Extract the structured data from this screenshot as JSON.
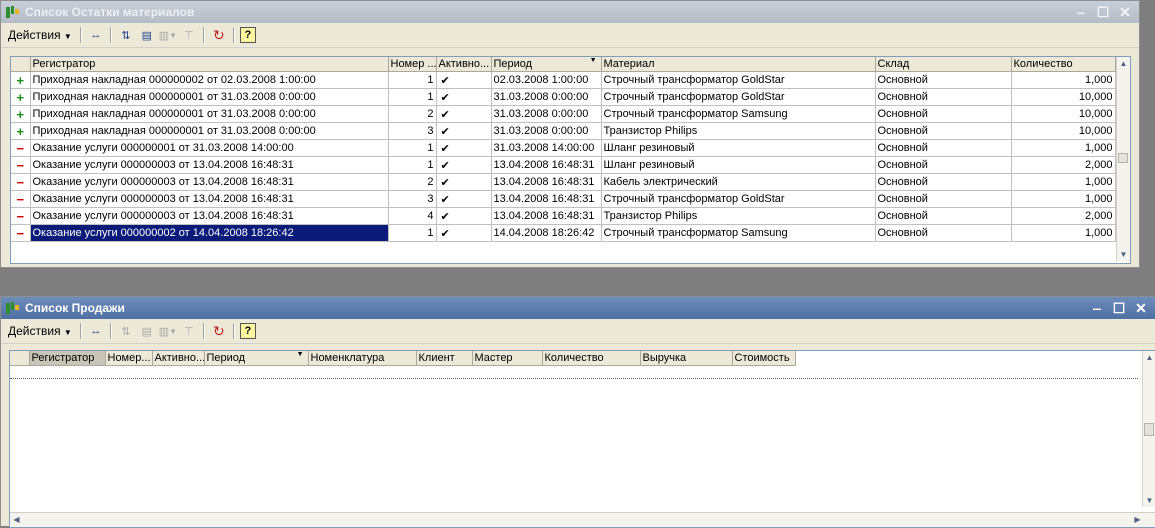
{
  "win1": {
    "title": "Список Остатки материалов",
    "toolbar": {
      "actions": "Действия"
    },
    "columns": [
      "Регистратор",
      "Номер ...",
      "Активно...",
      "Период",
      "Материал",
      "Склад",
      "Количество"
    ],
    "rows": [
      {
        "type": "plus",
        "mark": "+",
        "registrar": "Приходная накладная 000000002 от 02.03.2008 1:00:00",
        "num": "1",
        "active": "✔",
        "period": "02.03.2008 1:00:00",
        "material": "Строчный трансформатор GoldStar",
        "warehouse": "Основной",
        "qty": "1,000"
      },
      {
        "type": "plus",
        "mark": "+",
        "registrar": "Приходная накладная 000000001 от 31.03.2008 0:00:00",
        "num": "1",
        "active": "✔",
        "period": "31.03.2008 0:00:00",
        "material": "Строчный трансформатор GoldStar",
        "warehouse": "Основной",
        "qty": "10,000"
      },
      {
        "type": "plus",
        "mark": "+",
        "registrar": "Приходная накладная 000000001 от 31.03.2008 0:00:00",
        "num": "2",
        "active": "✔",
        "period": "31.03.2008 0:00:00",
        "material": "Строчный трансформатор Samsung",
        "warehouse": "Основной",
        "qty": "10,000"
      },
      {
        "type": "plus",
        "mark": "+",
        "registrar": "Приходная накладная 000000001 от 31.03.2008 0:00:00",
        "num": "3",
        "active": "✔",
        "period": "31.03.2008 0:00:00",
        "material": "Транзистор Philips",
        "warehouse": "Основной",
        "qty": "10,000"
      },
      {
        "type": "minus",
        "mark": "−",
        "registrar": "Оказание услуги 000000001 от 31.03.2008 14:00:00",
        "num": "1",
        "active": "✔",
        "period": "31.03.2008 14:00:00",
        "material": "Шланг резиновый",
        "warehouse": "Основной",
        "qty": "1,000"
      },
      {
        "type": "minus",
        "mark": "−",
        "registrar": "Оказание услуги 000000003 от 13.04.2008 16:48:31",
        "num": "1",
        "active": "✔",
        "period": "13.04.2008 16:48:31",
        "material": "Шланг резиновый",
        "warehouse": "Основной",
        "qty": "2,000"
      },
      {
        "type": "minus",
        "mark": "−",
        "registrar": "Оказание услуги 000000003 от 13.04.2008 16:48:31",
        "num": "2",
        "active": "✔",
        "period": "13.04.2008 16:48:31",
        "material": "Кабель электрический",
        "warehouse": "Основной",
        "qty": "1,000"
      },
      {
        "type": "minus",
        "mark": "−",
        "registrar": "Оказание услуги 000000003 от 13.04.2008 16:48:31",
        "num": "3",
        "active": "✔",
        "period": "13.04.2008 16:48:31",
        "material": "Строчный трансформатор GoldStar",
        "warehouse": "Основной",
        "qty": "1,000"
      },
      {
        "type": "minus",
        "mark": "−",
        "registrar": "Оказание услуги 000000003 от 13.04.2008 16:48:31",
        "num": "4",
        "active": "✔",
        "period": "13.04.2008 16:48:31",
        "material": "Транзистор Philips",
        "warehouse": "Основной",
        "qty": "2,000"
      },
      {
        "type": "minus",
        "mark": "−",
        "registrar": "Оказание услуги 000000002 от 14.04.2008 18:26:42",
        "num": "1",
        "active": "✔",
        "period": "14.04.2008 18:26:42",
        "material": "Строчный трансформатор Samsung",
        "warehouse": "Основной",
        "qty": "1,000",
        "selected": true
      }
    ]
  },
  "win2": {
    "title": "Список Продажи",
    "toolbar": {
      "actions": "Действия"
    },
    "columns": [
      "Регистратор",
      "Номер...",
      "Активно...",
      "Период",
      "Номенклатура",
      "Клиент",
      "Мастер",
      "Количество",
      "Выручка",
      "Стоимость"
    ]
  },
  "colors": {
    "selection": "#0a1b7a",
    "plus": "#1a8c1a",
    "minus": "#cc0000",
    "active_title": "#4f70a4"
  },
  "icons": [
    "app-icon",
    "caret-down-icon",
    "expand-columns-icon",
    "filter-icon",
    "copy-icon",
    "list-icon",
    "clear-filter-icon",
    "refresh-icon",
    "help-icon",
    "minimize-icon",
    "maximize-icon",
    "close-icon",
    "check-icon",
    "sort-desc-icon"
  ]
}
